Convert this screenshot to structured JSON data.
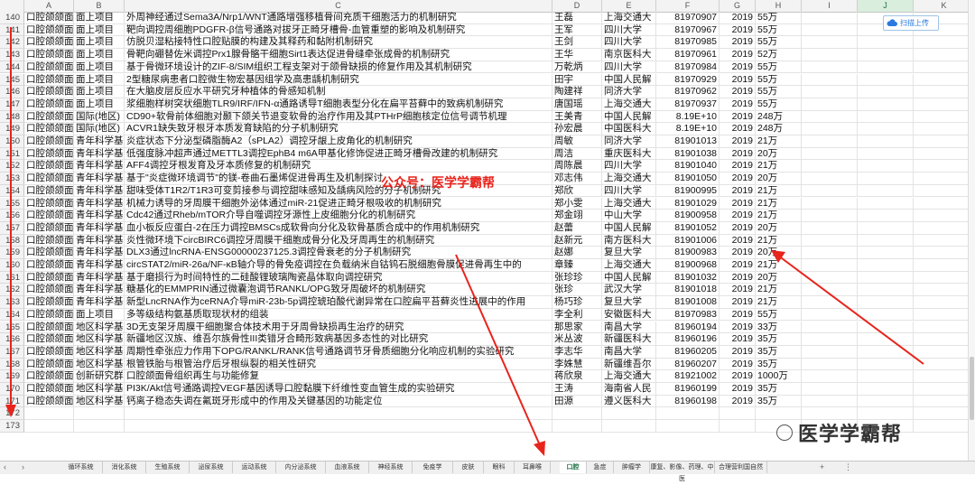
{
  "columns": [
    "A",
    "B",
    "C",
    "D",
    "E",
    "F",
    "G",
    "H",
    "I",
    "J",
    "K"
  ],
  "selected_column": "J",
  "rows": [
    {
      "n": "140",
      "a": "口腔颌颌面",
      "b": "面上项目",
      "c": "外周神经通过Sema3A/Nrp1/WNT通路增强移植骨间充质干细胞活力的机制研究",
      "d": "王磊",
      "e": "上海交通大",
      "f": "81970907",
      "g": "2019",
      "h": "55万"
    },
    {
      "n": "141",
      "a": "口腔颌颌面",
      "b": "面上项目",
      "c": "靶向调控周细胞PDGFR-β信号通路对拔牙正畸牙槽骨-血管重塑的影响及机制研究",
      "d": "王军",
      "e": "四川大学",
      "f": "81970967",
      "g": "2019",
      "h": "55万"
    },
    {
      "n": "142",
      "a": "口腔颌颌面",
      "b": "面上项目",
      "c": "仿脱贝湿粘接特性口腔贴膜的构建及其释药和黏附机制研究",
      "d": "王剑",
      "e": "四川大学",
      "f": "81970985",
      "g": "2019",
      "h": "55万"
    },
    {
      "n": "143",
      "a": "口腔颌颌面",
      "b": "面上项目",
      "c": "骨靶向硼替佐米调控Prx1腺骨骼干细胞Sirt1表达促进骨缝牵张成骨的机制研究",
      "d": "王华",
      "e": "南京医科大",
      "f": "81970961",
      "g": "2019",
      "h": "52万"
    },
    {
      "n": "144",
      "a": "口腔颌颌面",
      "b": "面上项目",
      "c": "基于骨微环境设计的ZIF-8/SIM组织工程支架对于颌骨缺损的修复作用及其机制研究",
      "d": "万乾炳",
      "e": "四川大学",
      "f": "81970984",
      "g": "2019",
      "h": "55万"
    },
    {
      "n": "145",
      "a": "口腔颌颌面",
      "b": "面上项目",
      "c": "2型糖尿病患者口腔微生物宏基因组学及高患龋机制研究",
      "d": "田宇",
      "e": "中国人民解",
      "f": "81970929",
      "g": "2019",
      "h": "55万"
    },
    {
      "n": "146",
      "a": "口腔颌颌面",
      "b": "面上项目",
      "c": "在大脑皮层反应水平研究牙种植体的骨感知机制",
      "d": "陶建祥",
      "e": "同济大学",
      "f": "81970962",
      "g": "2019",
      "h": "55万"
    },
    {
      "n": "147",
      "a": "口腔颌颌面",
      "b": "面上项目",
      "c": "浆细胞样树突状细胞TLR9/IRF/IFN-α通路诱导T细胞表型分化在扁平苔藓中的致病机制研究",
      "d": "唐国瑶",
      "e": "上海交通大",
      "f": "81970937",
      "g": "2019",
      "h": "55万"
    },
    {
      "n": "148",
      "a": "口腔颌颌面",
      "b": "国际(地区)",
      "c": "CD90+软骨前体细胞对颞下颌关节退变软骨的治疗作用及其PTHrP细胞核定位信号调节机理",
      "d": "王美青",
      "e": "中国人民解",
      "f": "8.19E+10",
      "g": "2019",
      "h": "248万"
    },
    {
      "n": "149",
      "a": "口腔颌颌面",
      "b": "国际(地区)",
      "c": "ACVR1缺失致牙根牙本质发育缺陷的分子机制研究",
      "d": "孙宏晨",
      "e": "中国医科大",
      "f": "8.19E+10",
      "g": "2019",
      "h": "248万"
    },
    {
      "n": "150",
      "a": "口腔颌颌面",
      "b": "青年科学基",
      "c": "炎症状态下分泌型磷脂酶A2（sPLA2）调控牙龈上皮角化的机制研究",
      "d": "周敏",
      "e": "同济大学",
      "f": "81901013",
      "g": "2019",
      "h": "21万"
    },
    {
      "n": "151",
      "a": "口腔颌颌面",
      "b": "青年科学基",
      "c": "低强度脉冲超声通过METTL3调控EphB4 m6A甲基化修饰促进正畸牙槽骨改建的机制研究",
      "d": "周洁",
      "e": "重庆医科大",
      "f": "81901038",
      "g": "2019",
      "h": "20万"
    },
    {
      "n": "152",
      "a": "口腔颌颌面",
      "b": "青年科学基",
      "c": "AFF4调控牙根发育及牙本质修复的机制研究",
      "d": "周陈晨",
      "e": "四川大学",
      "f": "81901040",
      "g": "2019",
      "h": "21万"
    },
    {
      "n": "153",
      "a": "口腔颌颌面",
      "b": "青年科学基",
      "c": "基于\"炎症微环境调节\"的镁-卷曲石墨烯促进骨再生及机制探讨",
      "d": "邓志伟",
      "e": "上海交通大",
      "f": "81901050",
      "g": "2019",
      "h": "20万"
    },
    {
      "n": "154",
      "a": "口腔颌颌面",
      "b": "青年科学基",
      "c": "甜味受体T1R2/T1R3可变剪接参与调控甜味感知及龋病风险的分子机制研究",
      "d": "郑欣",
      "e": "四川大学",
      "f": "81900995",
      "g": "2019",
      "h": "21万"
    },
    {
      "n": "155",
      "a": "口腔颌颌面",
      "b": "青年科学基",
      "c": "机械力诱导的牙周膜干细胞外泌体通过miR-21促进正畸牙根吸收的机制研究",
      "d": "郑小雯",
      "e": "上海交通大",
      "f": "81901029",
      "g": "2019",
      "h": "21万"
    },
    {
      "n": "156",
      "a": "口腔颌颌面",
      "b": "青年科学基",
      "c": "Cdc42通过Rheb/mTOR介导自噬调控牙源性上皮细胞分化的机制研究",
      "d": "郑金翊",
      "e": "中山大学",
      "f": "81900958",
      "g": "2019",
      "h": "21万"
    },
    {
      "n": "157",
      "a": "口腔颌颌面",
      "b": "青年科学基",
      "c": "血小板反应蛋白-2在压力调控BMSCs成软骨向分化及软骨基质合成中的作用机制研究",
      "d": "赵蕾",
      "e": "中国人民解",
      "f": "81901052",
      "g": "2019",
      "h": "20万"
    },
    {
      "n": "158",
      "a": "口腔颌颌面",
      "b": "青年科学基",
      "c": "炎性微环境下circBIRC6调控牙周膜干细胞成骨分化及牙周再生的机制研究",
      "d": "赵新元",
      "e": "南方医科大",
      "f": "81901006",
      "g": "2019",
      "h": "21万"
    },
    {
      "n": "159",
      "a": "口腔颌颌面",
      "b": "青年科学基",
      "c": "DLX3通过lncRNA-ENSG00000237125.3调控骨衰老的分子机制研究",
      "d": "赵娜",
      "e": "复旦大学",
      "f": "81900983",
      "g": "2019",
      "h": "20万"
    },
    {
      "n": "160",
      "a": "口腔颌颌面",
      "b": "青年科学基",
      "c": "circSTAT2/miR-26a/NF-κB轴介导的骨免疫调控在负载纳米自钴钨石脱细胞骨膜促进骨再生中的",
      "d": "章臻",
      "e": "上海交通大",
      "f": "81900968",
      "g": "2019",
      "h": "21万"
    },
    {
      "n": "161",
      "a": "口腔颌颌面",
      "b": "青年科学基",
      "c": "基于磨损行为时间特性的二硅酸锂玻璃陶瓷晶体取向调控研究",
      "d": "张珍珍",
      "e": "中国人民解",
      "f": "81901032",
      "g": "2019",
      "h": "20万"
    },
    {
      "n": "162",
      "a": "口腔颌颌面",
      "b": "青年科学基",
      "c": "糖基化的EMMPRIN通过微囊泡调节RANKL/OPG致牙周破坏的机制研究",
      "d": "张珍",
      "e": "武汉大学",
      "f": "81901018",
      "g": "2019",
      "h": "21万"
    },
    {
      "n": "163",
      "a": "口腔颌颌面",
      "b": "青年科学基",
      "c": "新型LncRNA作为ceRNA介导miR-23b-5p调控琥珀酸代谢异常在口腔扁平苔藓炎性进展中的作用",
      "d": "杨巧珍",
      "e": "复旦大学",
      "f": "81901008",
      "g": "2019",
      "h": "21万"
    },
    {
      "n": "164",
      "a": "口腔颌颌面",
      "b": "面上项目",
      "c": "多等级结构氨基质取现状材的组装",
      "d": "李全利",
      "e": "安徽医科大",
      "f": "81970983",
      "g": "2019",
      "h": "55万"
    },
    {
      "n": "165",
      "a": "口腔颌颌面",
      "b": "地区科学基",
      "c": "3D无支架牙周膜干细胞聚合体技术用于牙周骨缺损再生治疗的研究",
      "d": "那思家",
      "e": "南昌大学",
      "f": "81960194",
      "g": "2019",
      "h": "33万"
    },
    {
      "n": "166",
      "a": "口腔颌颌面",
      "b": "地区科学基",
      "c": "新疆地区汉族、维吾尔族骨性III类错牙合畸形致病基因多态性的对比研究",
      "d": "米丛波",
      "e": "新疆医科大",
      "f": "81960196",
      "g": "2019",
      "h": "35万"
    },
    {
      "n": "167",
      "a": "口腔颌颌面",
      "b": "地区科学基",
      "c": "周期性牵张应力作用下OPG/RANKL/RANK信号通路调节牙骨质细胞分化响应机制的实验研究",
      "d": "李志华",
      "e": "南昌大学",
      "f": "81960205",
      "g": "2019",
      "h": "35万"
    },
    {
      "n": "168",
      "a": "口腔颌颌面",
      "b": "地区科学基",
      "c": "根管铁胎与根管治疗后牙根纵裂的相关性研究",
      "d": "李姝慧",
      "e": "新疆维吾尔",
      "f": "81960207",
      "g": "2019",
      "h": "35万"
    },
    {
      "n": "169",
      "a": "口腔颌颌面",
      "b": "创新研究群",
      "c": "口腔颌面骨组织再生与功能修复",
      "d": "蒋欣泉",
      "e": "上海交通大",
      "f": "81921002",
      "g": "2019",
      "h": "1000万"
    },
    {
      "n": "170",
      "a": "口腔颌颌面",
      "b": "地区科学基",
      "c": "PI3K/Akt信号通路调控VEGF基因诱导口腔黏膜下纤维性变血管生成的实验研究",
      "d": "王涛",
      "e": "海南省人民",
      "f": "81960199",
      "g": "2019",
      "h": "35万"
    },
    {
      "n": "171",
      "a": "口腔颌颌面",
      "b": "地区科学基",
      "c": "钙离子稳态失调在氟斑牙形成中的作用及关键基因的功能定位",
      "d": "田源",
      "e": "遵义医科大",
      "f": "81960198",
      "g": "2019",
      "h": "35万"
    },
    {
      "n": "172",
      "a": "",
      "b": "",
      "c": "",
      "d": "",
      "e": "",
      "f": "",
      "g": "",
      "h": ""
    },
    {
      "n": "173",
      "a": "",
      "b": "",
      "c": "",
      "d": "",
      "e": "",
      "f": "",
      "g": "",
      "h": ""
    }
  ],
  "watermark": "公众号：医学学霸帮",
  "upload_button": "扫描上传",
  "logo_text": "医学学霸帮",
  "tab_nav": {
    "prev": "‹",
    "next": "›",
    "add": "+",
    "more": "⋮"
  },
  "tabs": [
    "循环系统",
    "消化系统",
    "生殖系统",
    "泌尿系统",
    "运动系统",
    "内分泌系统",
    "血液系统",
    "神经系统",
    "免疫学",
    "皮肤",
    "眼科",
    "耳鼻喉",
    "口腔",
    "急症",
    "肿瘤学",
    "康复、影像、药理、中医",
    "合理营利国自然"
  ],
  "active_tab": "口腔",
  "colors": {
    "accent": "#217346",
    "annotation": "#e8241c",
    "upload": "#2a7ae2"
  }
}
